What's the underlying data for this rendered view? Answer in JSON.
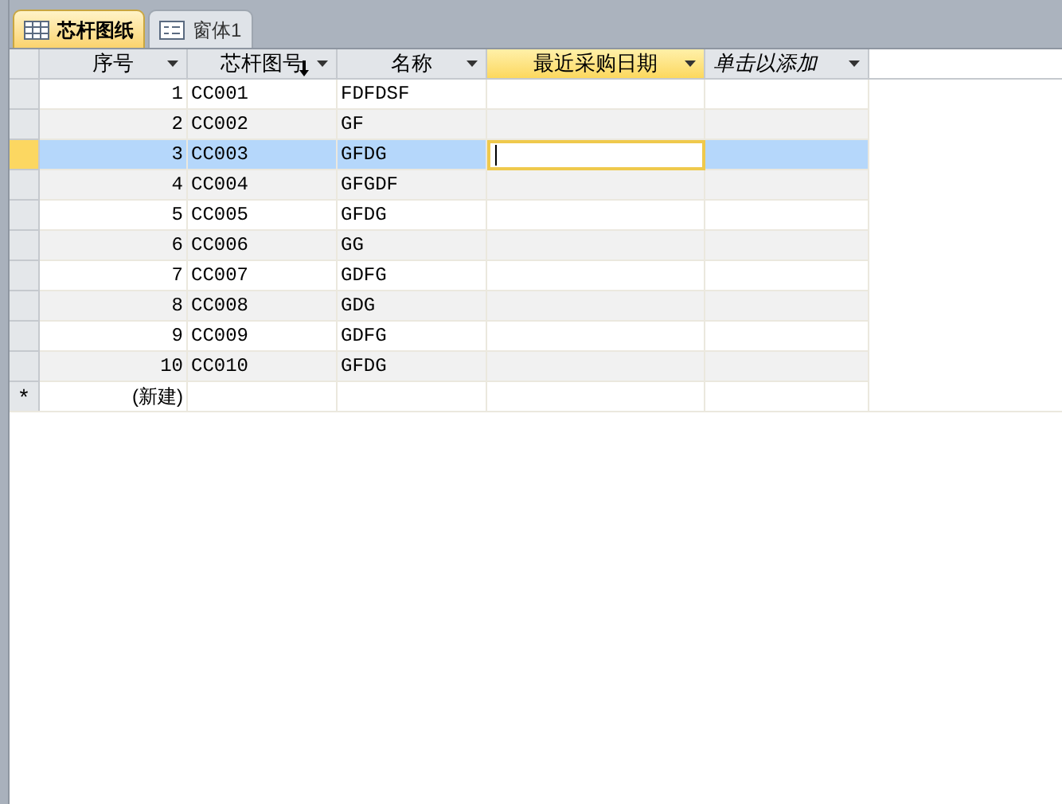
{
  "tabs": [
    {
      "label": "芯杆图纸",
      "kind": "table",
      "selected": true
    },
    {
      "label": "窗体1",
      "kind": "form",
      "selected": false
    }
  ],
  "columns": [
    {
      "label": "序号",
      "kind": "field",
      "selected": false,
      "sorted": false
    },
    {
      "label": "芯杆图号",
      "kind": "field",
      "selected": false,
      "sorted": true
    },
    {
      "label": "名称",
      "kind": "field",
      "selected": false,
      "sorted": false
    },
    {
      "label": "最近采购日期",
      "kind": "field",
      "selected": true,
      "sorted": false
    },
    {
      "label": "单击以添加",
      "kind": "add",
      "selected": false,
      "sorted": false
    }
  ],
  "rows": [
    {
      "cells": [
        "1",
        "CC001",
        "FDFDSF"
      ],
      "selected": false
    },
    {
      "cells": [
        "2",
        "CC002",
        "GF"
      ],
      "selected": false
    },
    {
      "cells": [
        "3",
        "CC003",
        "GFDG"
      ],
      "selected": true
    },
    {
      "cells": [
        "4",
        "CC004",
        "GFGDF"
      ],
      "selected": false
    },
    {
      "cells": [
        "5",
        "CC005",
        "GFDG"
      ],
      "selected": false
    },
    {
      "cells": [
        "6",
        "CC006",
        "GG"
      ],
      "selected": false
    },
    {
      "cells": [
        "7",
        "CC007",
        "GDFG"
      ],
      "selected": false
    },
    {
      "cells": [
        "8",
        "CC008",
        "GDG"
      ],
      "selected": false
    },
    {
      "cells": [
        "9",
        "CC009",
        "GDFG"
      ],
      "selected": false
    },
    {
      "cells": [
        "10",
        "CC010",
        "GFDG"
      ],
      "selected": false
    }
  ],
  "new_row": {
    "marker": "*",
    "label": "(新建)"
  }
}
